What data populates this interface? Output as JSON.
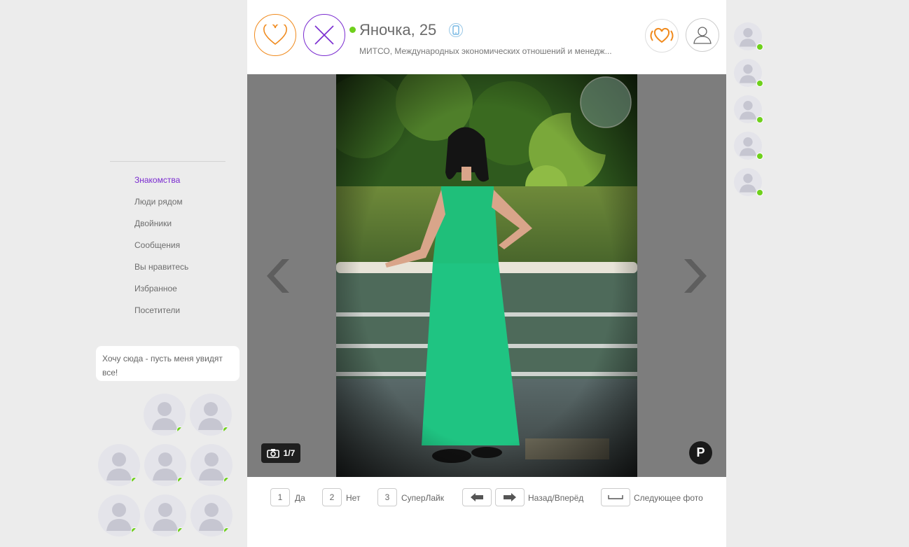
{
  "sidebar": {
    "nav": [
      {
        "label": "Знакомства",
        "active": true
      },
      {
        "label": "Люди рядом",
        "active": false
      },
      {
        "label": "Двойники",
        "active": false
      },
      {
        "label": "Сообщения",
        "active": false
      },
      {
        "label": "Вы нравитесь",
        "active": false
      },
      {
        "label": "Избранное",
        "active": false
      },
      {
        "label": "Посетители",
        "active": false
      }
    ],
    "promo_text": "Хочу сюда - пусть меня увидят все!"
  },
  "profile": {
    "name_age": "Яночка, 25",
    "subtitle": "МИТСО, Международных экономических отношений и менедж...",
    "online": true
  },
  "photo": {
    "counter": "1/7",
    "badge": "P"
  },
  "hints": {
    "yes_key": "1",
    "yes_label": "Да",
    "no_key": "2",
    "no_label": "Нет",
    "super_key": "3",
    "super_label": "СуперЛайк",
    "nav_label": "Назад/Вперёд",
    "next_label": "Следующее фото"
  },
  "colors": {
    "like": "#f08a1d",
    "dislike": "#7a2bd0",
    "online": "#6fd01c",
    "active_nav": "#7a2bd0"
  }
}
